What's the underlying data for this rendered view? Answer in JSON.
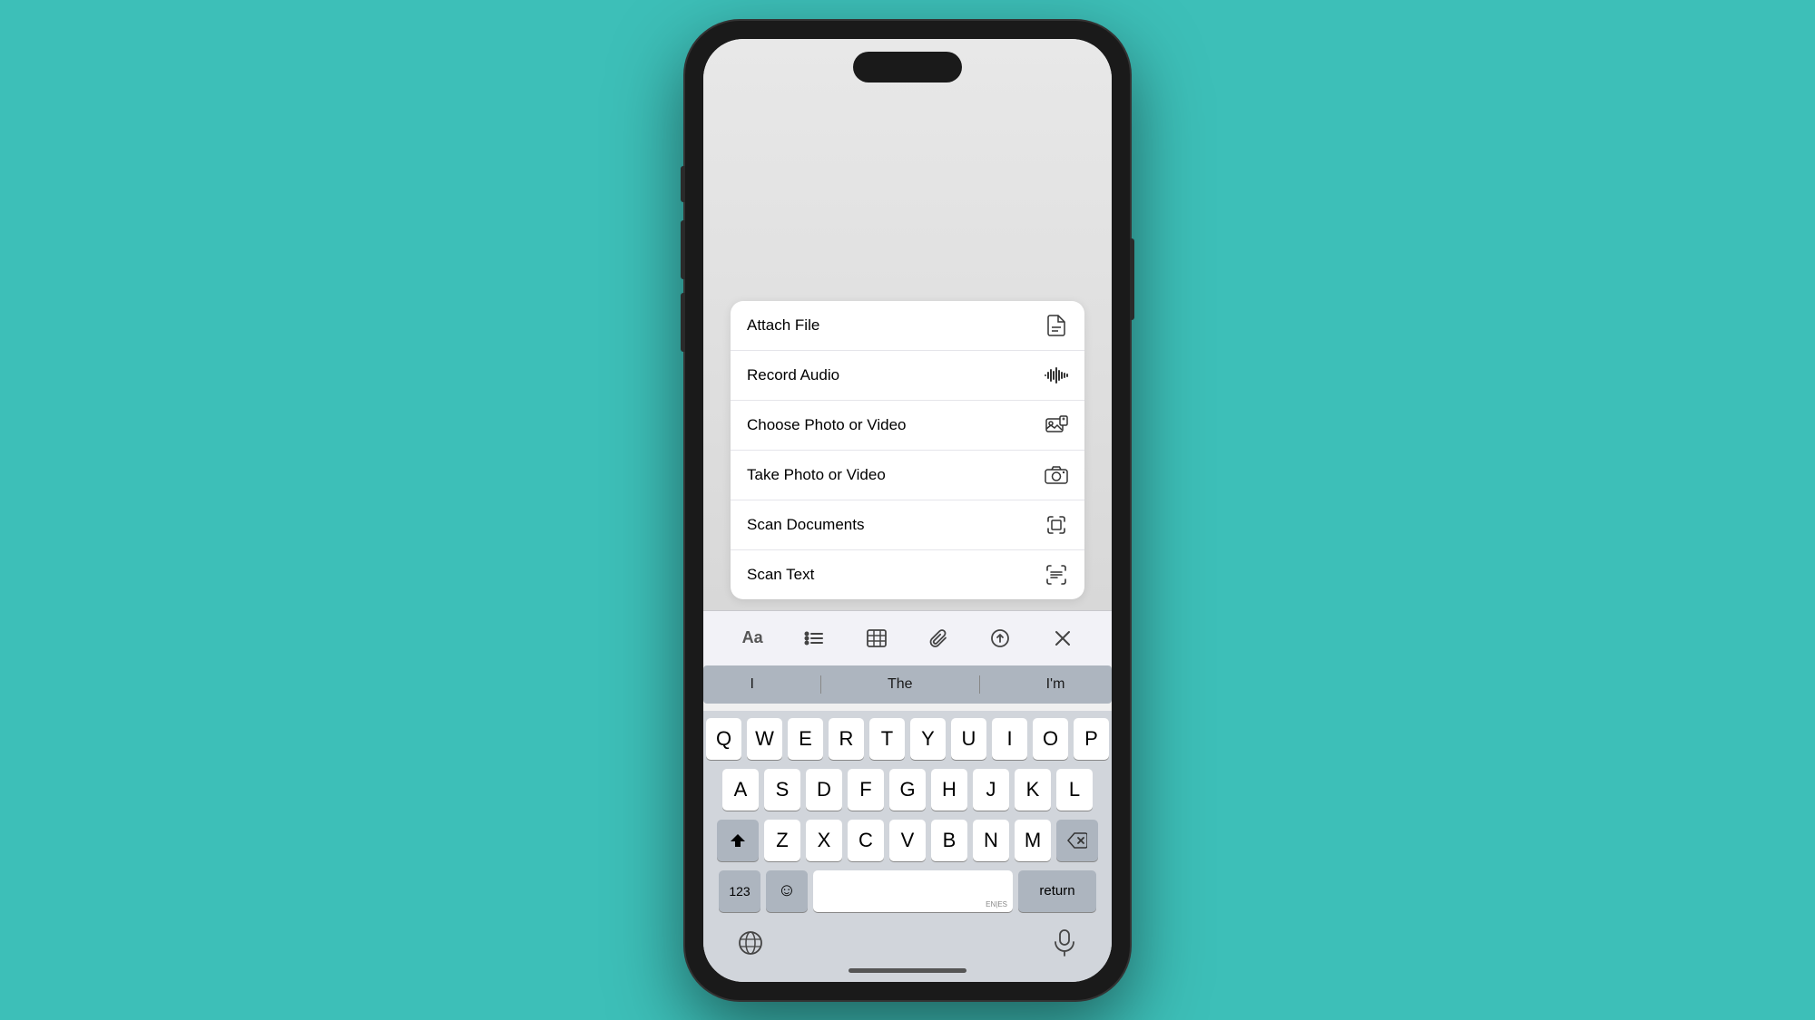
{
  "background": {
    "color": "#3dbfb8"
  },
  "phone": {
    "menu": {
      "items": [
        {
          "id": "attach-file",
          "label": "Attach File",
          "icon": "file-icon"
        },
        {
          "id": "record-audio",
          "label": "Record Audio",
          "icon": "audio-icon"
        },
        {
          "id": "choose-photo-video",
          "label": "Choose Photo or Video",
          "icon": "photo-icon"
        },
        {
          "id": "take-photo-video",
          "label": "Take Photo or Video",
          "icon": "camera-icon"
        },
        {
          "id": "scan-documents",
          "label": "Scan Documents",
          "icon": "scan-doc-icon"
        },
        {
          "id": "scan-text",
          "label": "Scan Text",
          "icon": "scan-text-icon"
        }
      ]
    },
    "toolbar": {
      "items": [
        "Aa",
        "list-icon",
        "grid-icon",
        "clip-icon",
        "arrow-icon",
        "close-icon"
      ]
    },
    "keyboard": {
      "predictive": [
        "I",
        "The",
        "I'm"
      ],
      "rows": [
        [
          "Q",
          "W",
          "E",
          "R",
          "T",
          "Y",
          "U",
          "I",
          "O",
          "P"
        ],
        [
          "A",
          "S",
          "D",
          "F",
          "G",
          "H",
          "J",
          "K",
          "L"
        ],
        [
          "Z",
          "X",
          "C",
          "V",
          "B",
          "N",
          "M"
        ]
      ],
      "bottom": {
        "num_label": "123",
        "space_label": "",
        "space_lang": "EN|ES",
        "return_label": "return"
      }
    },
    "home_indicator": ""
  }
}
